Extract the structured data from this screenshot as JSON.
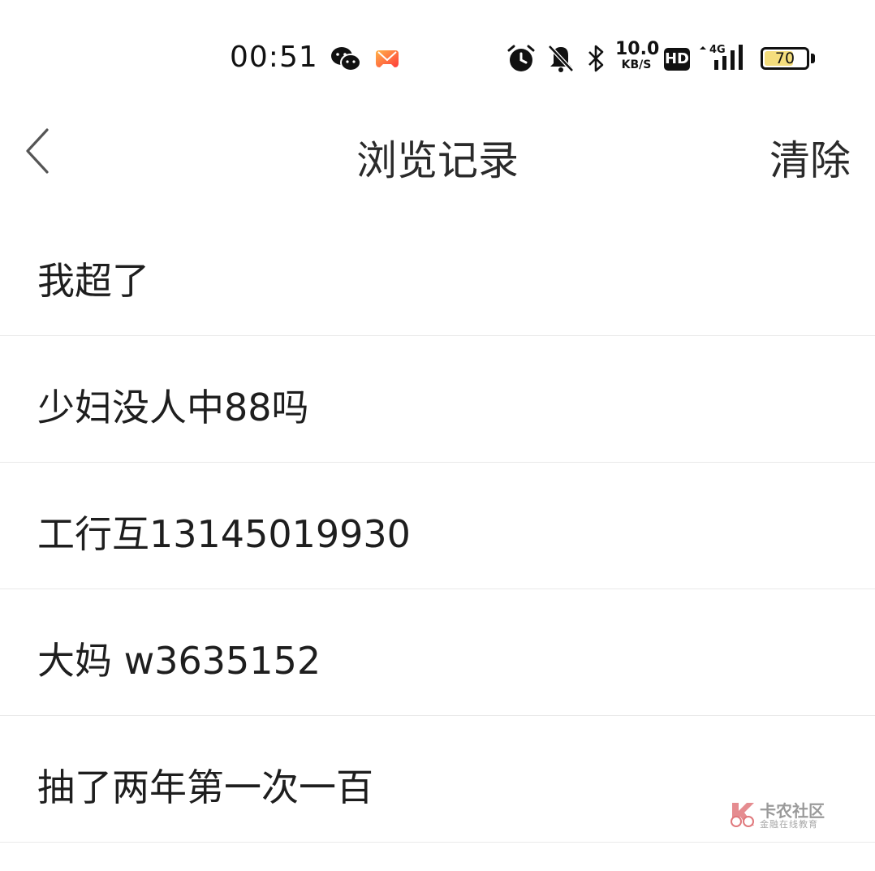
{
  "status_bar": {
    "time": "00:51",
    "net_speed_value": "10.0",
    "net_speed_unit": "KB/S",
    "hd_label": "HD",
    "signal_label": "4G",
    "battery_percent": 70,
    "battery_label": "70",
    "battery_color": "#f4dd7d",
    "icons": [
      "wechat-icon",
      "game-icon",
      "alarm-icon",
      "mute-icon",
      "bluetooth-icon",
      "signal-icon"
    ]
  },
  "header": {
    "back_icon": "chevron-left-icon",
    "title": "浏览记录",
    "clear_label": "清除"
  },
  "history": {
    "items": [
      {
        "text": "我超了"
      },
      {
        "text": "少妇没人中88吗"
      },
      {
        "text": "工行互13145019930"
      },
      {
        "text": "大妈 w3635152"
      },
      {
        "text": "抽了两年第一次一百"
      }
    ]
  },
  "watermark": {
    "title": "卡农社区",
    "subtitle": "金融在线教育",
    "logo_color": "#e0787c"
  }
}
